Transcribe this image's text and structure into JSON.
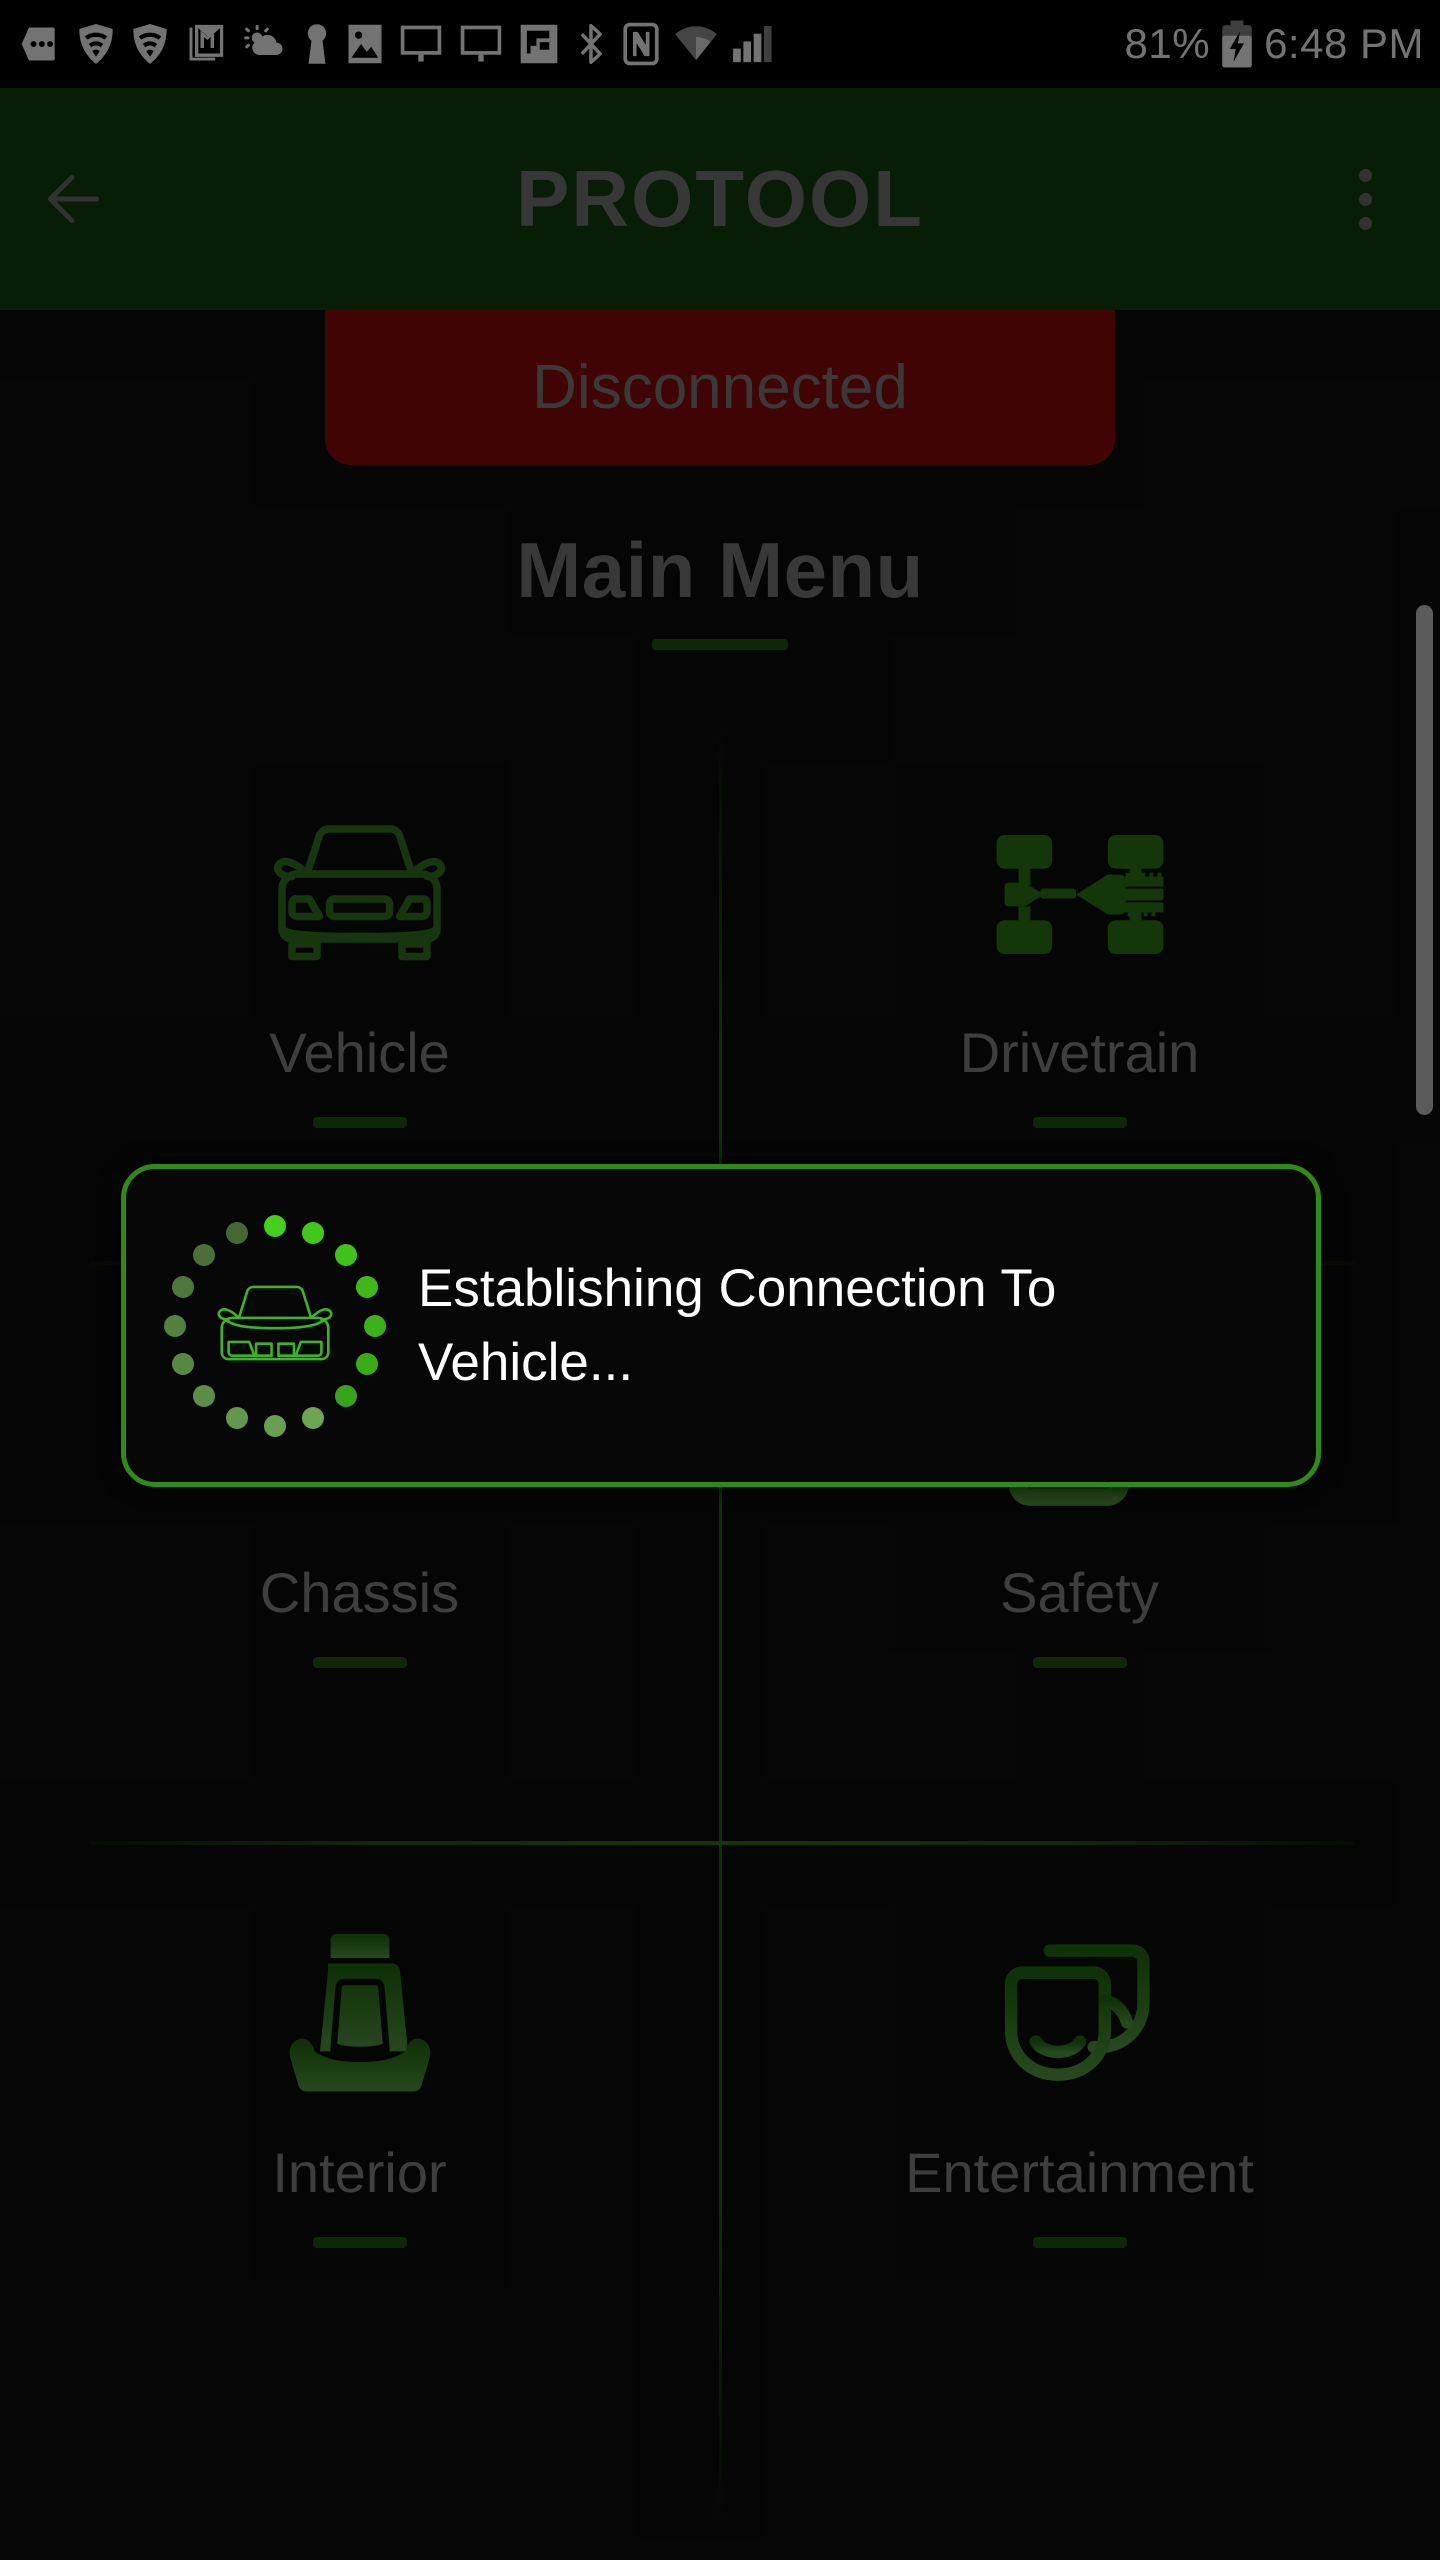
{
  "statusbar": {
    "icons": [
      "more-messages-icon",
      "wifi-shield-icon",
      "wifi-shield-icon-2",
      "gmail-icon",
      "weather-partly-cloudy-icon",
      "keyhole-icon",
      "photos-icon",
      "cast-screen-icon",
      "cast-screen-icon-2",
      "flipboard-icon",
      "bluetooth-icon",
      "nfc-icon",
      "wifi-icon",
      "cell-signal-icon"
    ],
    "battery_percent": "81%",
    "battery_icon": "battery-charging-icon",
    "time": "6:48 PM"
  },
  "appbar": {
    "back_icon": "back-arrow-icon",
    "title": "PROTOOL",
    "overflow_icon": "overflow-menu-icon"
  },
  "connection": {
    "status_label": "Disconnected",
    "status_color": "#8e0b0b"
  },
  "page": {
    "title": "Main Menu"
  },
  "menu": {
    "tiles": [
      {
        "label": "Vehicle",
        "icon": "car-front-outline-icon"
      },
      {
        "label": "Drivetrain",
        "icon": "drivetrain-axle-icon"
      },
      {
        "label": "Chassis",
        "icon": "chassis-axle-icon"
      },
      {
        "label": "Safety",
        "icon": "checkbox-check-icon"
      },
      {
        "label": "Interior",
        "icon": "car-seat-icon"
      },
      {
        "label": "Entertainment",
        "icon": "theater-masks-icon"
      }
    ]
  },
  "modal": {
    "message": "Establishing Connection To Vehicle...",
    "spinner_icon": "loading-dots-spinner",
    "center_icon": "car-front-line-icon",
    "border_color": "#2e8b14",
    "accent_color": "#44d11b"
  },
  "scrollbar": {
    "thumb": "scrollbar-thumb"
  }
}
